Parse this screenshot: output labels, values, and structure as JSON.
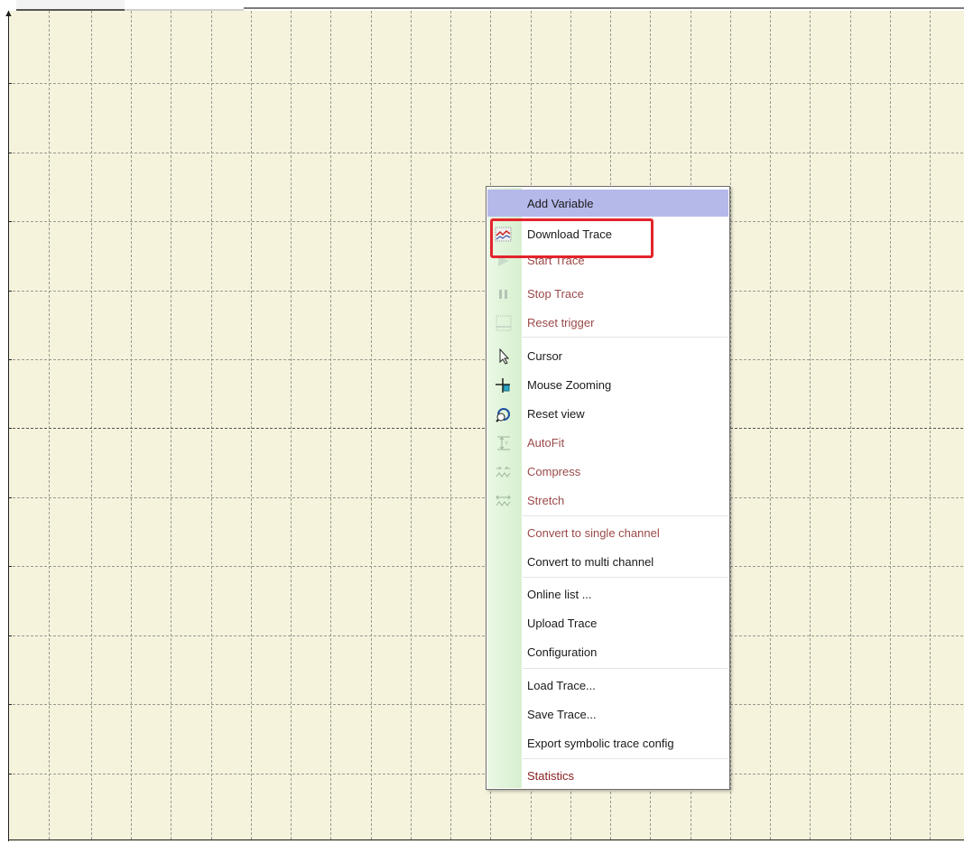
{
  "theme": {
    "plot_background": "#f5f3dc",
    "grid_color": "#9a9a90",
    "menu_highlight": "#b5b9ea",
    "callout_color": "#e3242b",
    "red_text": "#8a2020"
  },
  "menu": {
    "items": [
      {
        "label": "Add Variable",
        "icon": "",
        "highlighted": true
      },
      {
        "label": "Download Trace",
        "icon": "download-trace-icon",
        "highlighted": false
      },
      {
        "label": "Start Trace",
        "icon": "play-icon",
        "highlighted": false
      },
      {
        "label": "Stop Trace",
        "icon": "pause-icon",
        "highlighted": false
      },
      {
        "label": "Reset trigger",
        "icon": "reset-trigger-icon",
        "highlighted": false
      },
      {
        "label": "Cursor",
        "icon": "cursor-arrow-icon",
        "highlighted": false
      },
      {
        "label": "Mouse Zooming",
        "icon": "zoom-cross-icon",
        "highlighted": false
      },
      {
        "label": "Reset view",
        "icon": "reset-view-icon",
        "highlighted": false
      },
      {
        "label": "AutoFit",
        "icon": "autofit-icon",
        "highlighted": false
      },
      {
        "label": "Compress",
        "icon": "compress-icon",
        "highlighted": false
      },
      {
        "label": "Stretch",
        "icon": "stretch-icon",
        "highlighted": false
      },
      {
        "label": "Convert to single channel",
        "icon": "",
        "highlighted": false
      },
      {
        "label": "Convert to multi channel",
        "icon": "",
        "highlighted": false
      },
      {
        "label": "Online list ...",
        "icon": "",
        "highlighted": false
      },
      {
        "label": "Upload Trace",
        "icon": "",
        "highlighted": false
      },
      {
        "label": "Configuration",
        "icon": "",
        "highlighted": false
      },
      {
        "label": "Load Trace...",
        "icon": "",
        "highlighted": false
      },
      {
        "label": "Save Trace...",
        "icon": "",
        "highlighted": false
      },
      {
        "label": "Export symbolic trace config",
        "icon": "",
        "highlighted": false
      },
      {
        "label": "Statistics",
        "icon": "",
        "highlighted": false
      }
    ]
  }
}
